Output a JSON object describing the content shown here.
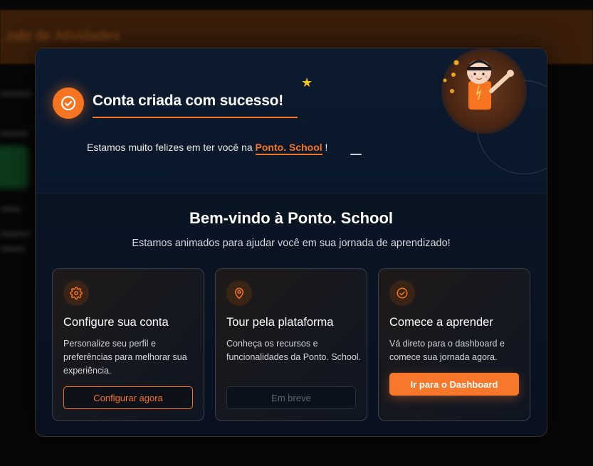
{
  "background": {
    "bar_text": "...ndo de Atividades"
  },
  "hero": {
    "title": "Conta criada com sucesso!",
    "welcome_prefix": "Estamos muito felizes em ter você na",
    "brand": "Ponto. School",
    "welcome_suffix": "!"
  },
  "main": {
    "title": "Bem-vindo à Ponto. School",
    "subtitle": "Estamos animados para ajudar você em sua jornada de aprendizado!"
  },
  "cards": [
    {
      "icon": "gear-icon",
      "title": "Configure sua conta",
      "description": "Personalize seu perfil e preferências para melhorar sua experiência.",
      "button": "Configurar agora"
    },
    {
      "icon": "map-pin-icon",
      "title": "Tour pela plataforma",
      "description": "Conheça os recursos e funcionalidades da Ponto. School.",
      "button": "Em breve"
    },
    {
      "icon": "check-circle-icon",
      "title": "Comece a aprender",
      "description": "Vá direto para o dashboard e comece sua jornada agora.",
      "button": "Ir para o Dashboard"
    }
  ],
  "colors": {
    "accent": "#f77420",
    "star": "#f7c51e",
    "modal_bg": "#0a1524"
  }
}
